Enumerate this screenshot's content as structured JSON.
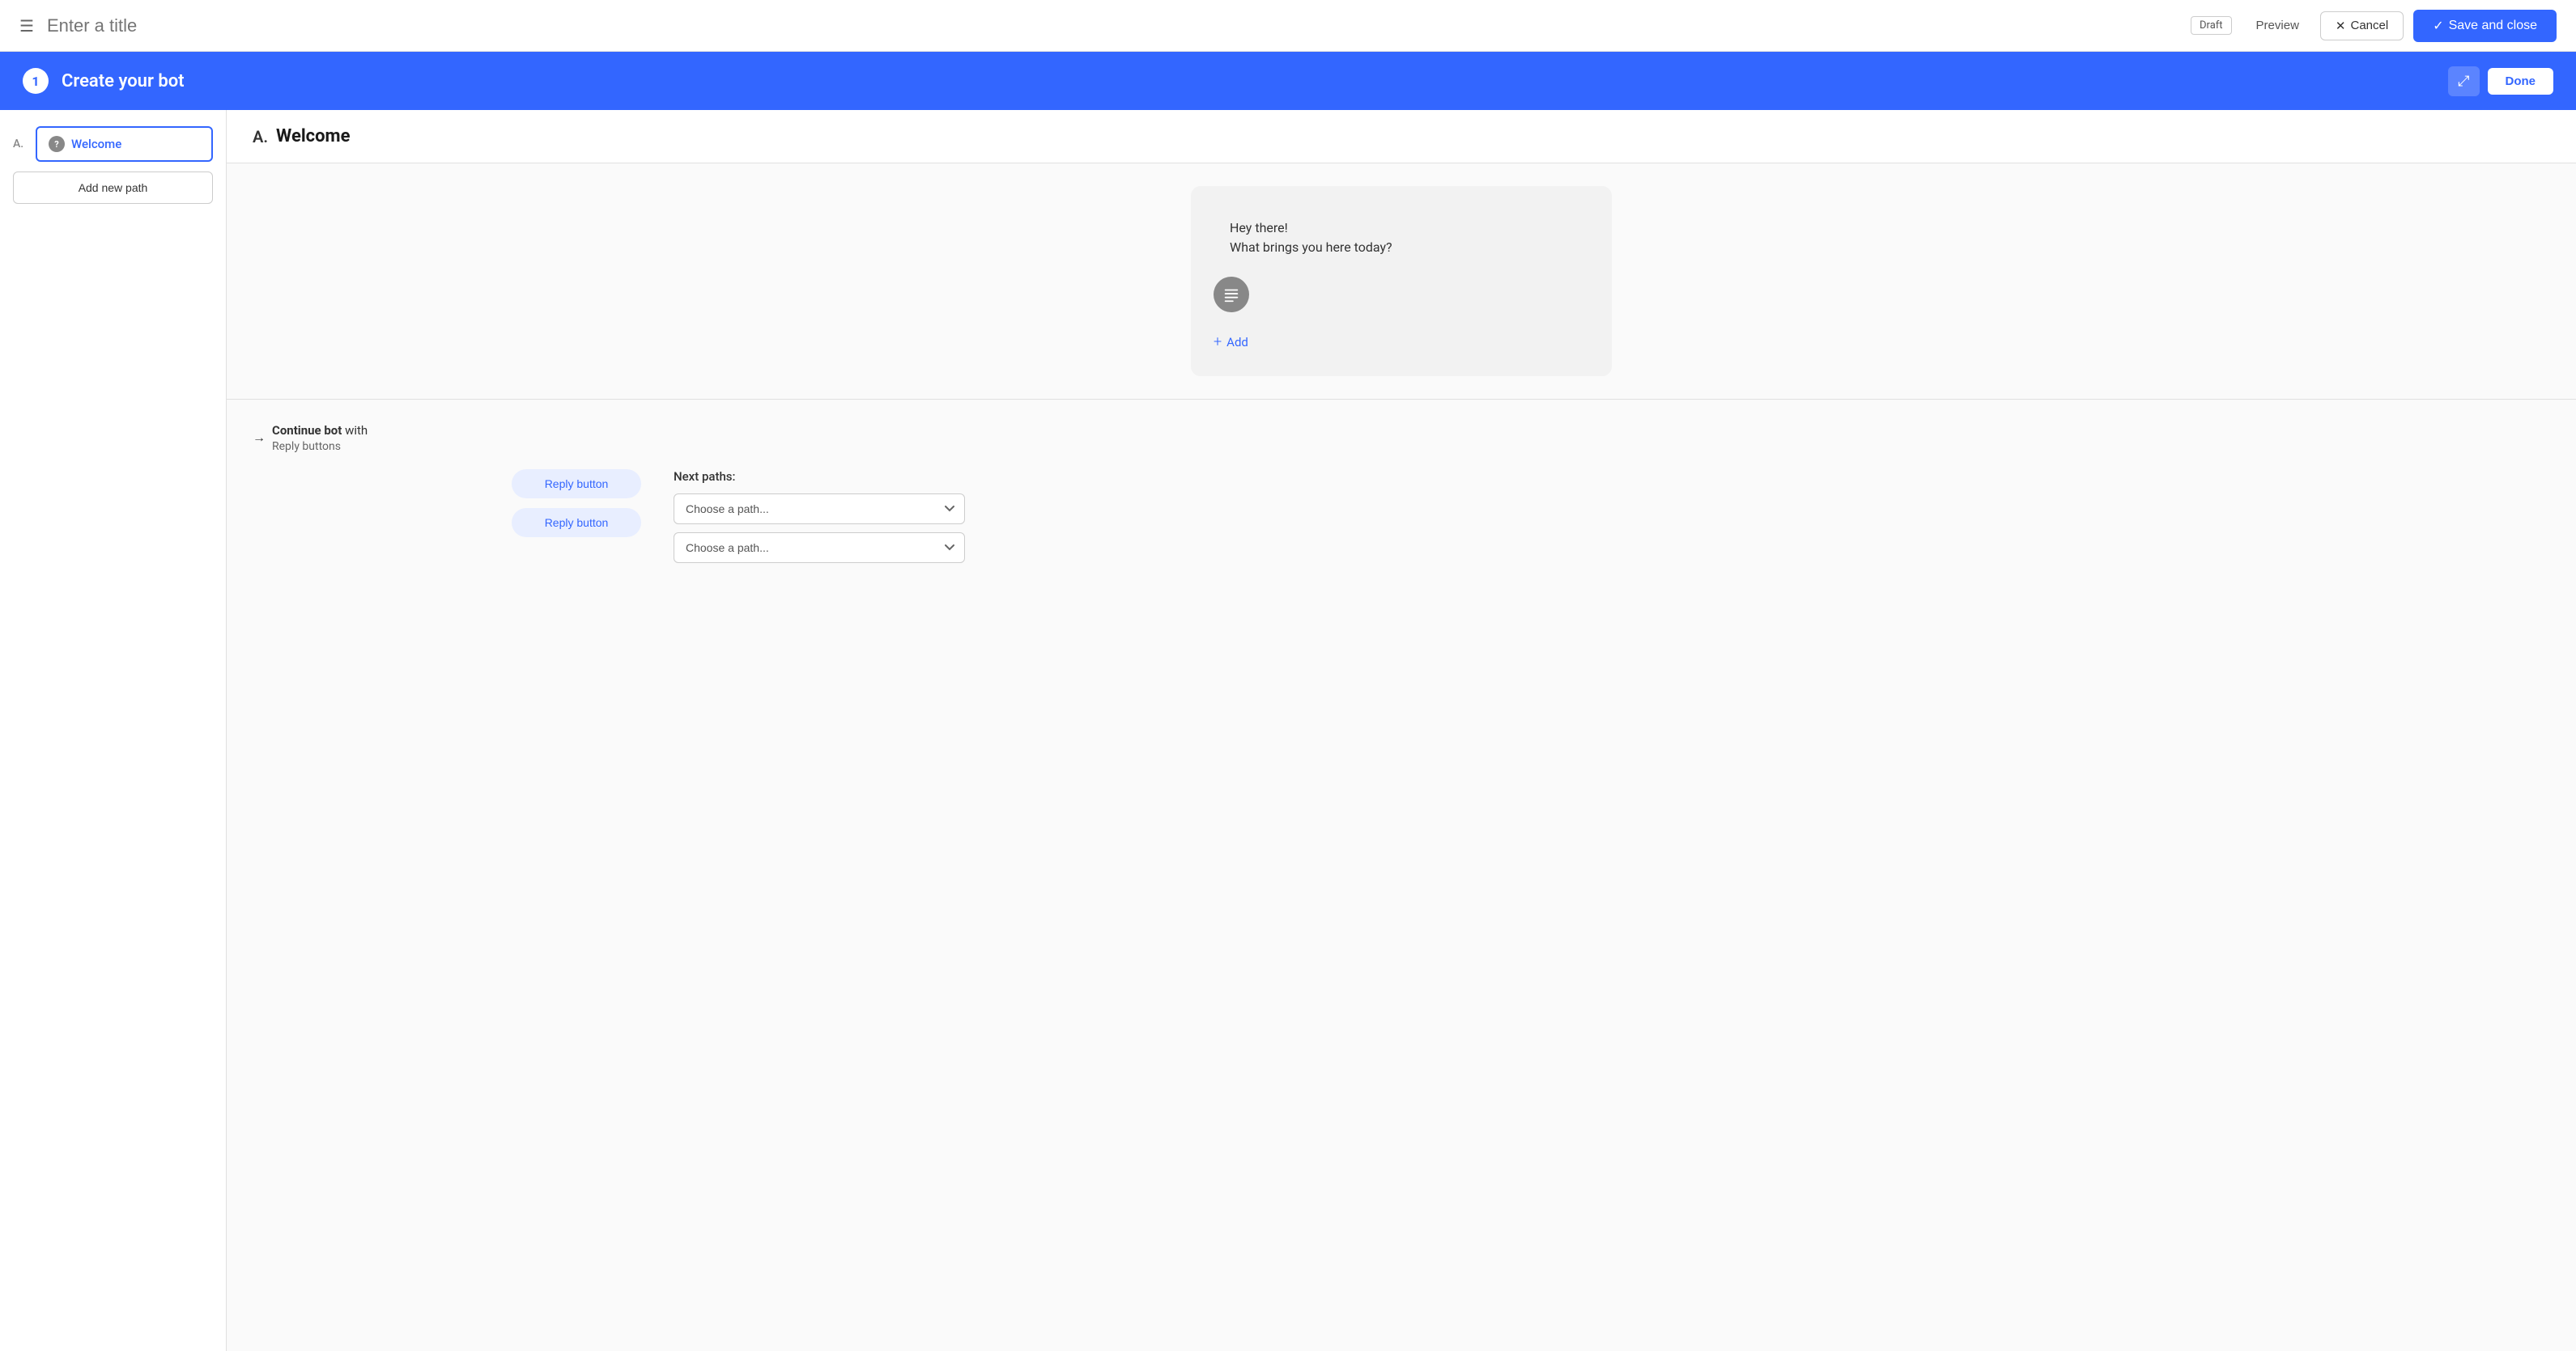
{
  "topbar": {
    "title_placeholder": "Enter a title",
    "draft_label": "Draft",
    "preview_label": "Preview",
    "cancel_label": "Cancel",
    "save_close_label": "Save and close"
  },
  "bot_header": {
    "step_number": "1",
    "title": "Create your bot",
    "done_label": "Done"
  },
  "sidebar": {
    "path_label": "A.",
    "path_item": {
      "label": "Welcome"
    },
    "add_path_label": "Add new path"
  },
  "content": {
    "path_letter": "A.",
    "path_name": "Welcome",
    "chat_messages": [
      "Hey there!",
      "What brings you here today?"
    ],
    "add_label": "+ Add",
    "continue_bot": {
      "prefix": "Continue bot",
      "with_text": "with",
      "method": "Reply buttons",
      "next_paths_label": "Next paths:"
    },
    "reply_buttons": [
      "Reply button",
      "Reply button"
    ],
    "path_select_placeholder": "Choose a path..."
  }
}
